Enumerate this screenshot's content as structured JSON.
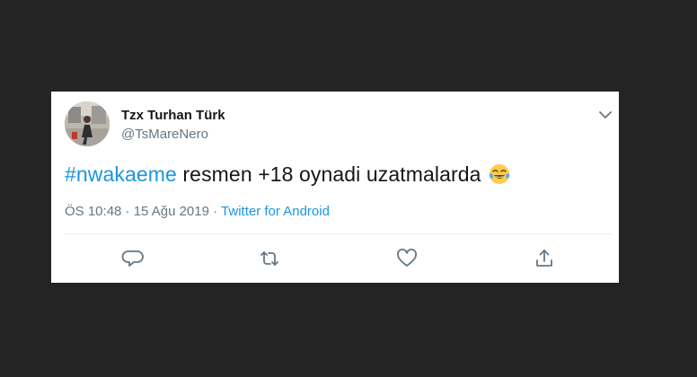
{
  "tweet": {
    "display_name": "Tzx Turhan Türk",
    "handle": "@TsMareNero",
    "hashtag": "#nwakaeme",
    "text": " resmen +18 oynadi uzatmalarda ",
    "emoji": "face-with-tears-of-joy",
    "time": "ÖS 10:48 · 15 Ağu 2019 · ",
    "source": "Twitter for Android"
  },
  "icons": {
    "caret": "chevron-down-icon",
    "reply": "reply-icon",
    "retweet": "retweet-icon",
    "like": "heart-icon",
    "share": "share-icon"
  },
  "colors": {
    "background": "#242424",
    "card": "#ffffff",
    "link": "#1b95e0",
    "secondary_text": "#657786",
    "primary_text": "#14171a"
  }
}
